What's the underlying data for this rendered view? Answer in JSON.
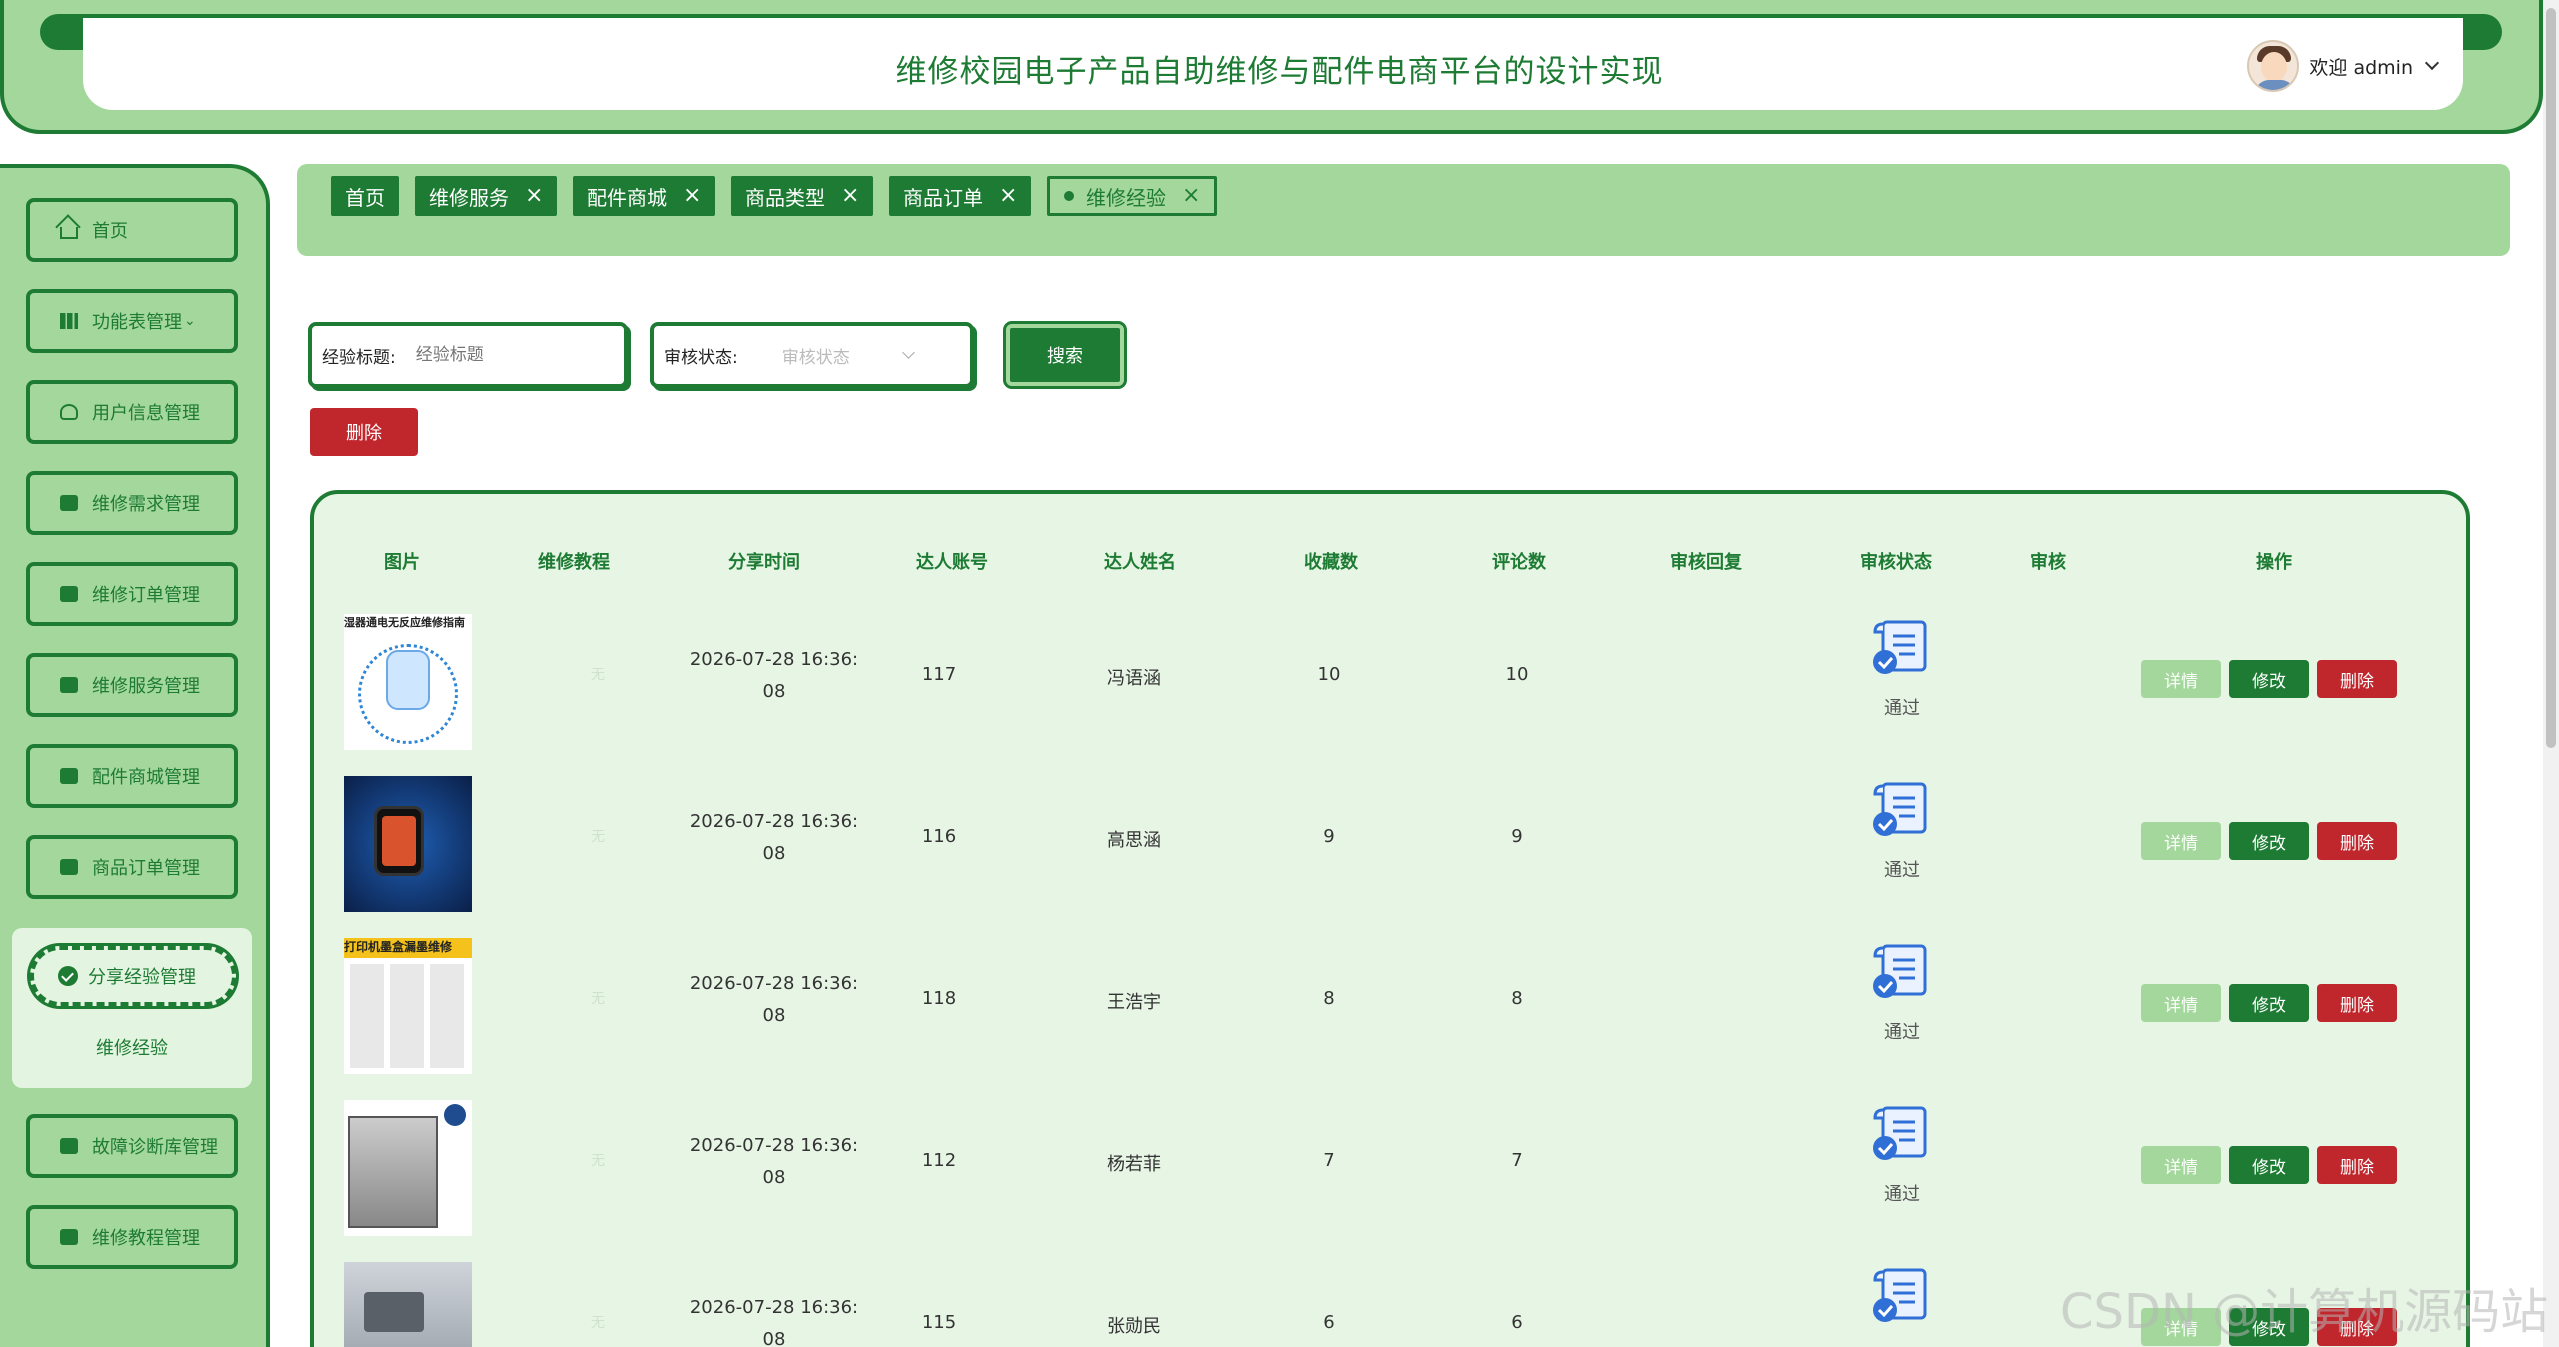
{
  "header": {
    "title": "维修校园电子产品自助维修与配件电商平台的设计实现",
    "welcome": "欢迎 admin"
  },
  "sidebar": {
    "items": [
      {
        "label": "首页",
        "icon": "home-icon"
      },
      {
        "label": "功能表管理",
        "icon": "building-icon"
      },
      {
        "label": "用户信息管理",
        "icon": "user-icon"
      },
      {
        "label": "维修需求管理",
        "icon": "gear-icon"
      },
      {
        "label": "维修订单管理",
        "icon": "cart-icon"
      },
      {
        "label": "维修服务管理",
        "icon": "folder-icon"
      },
      {
        "label": "配件商城管理",
        "icon": "gear-icon"
      },
      {
        "label": "商品订单管理",
        "icon": "card-icon"
      },
      {
        "label": "分享经验管理",
        "icon": "check-circle-icon"
      },
      {
        "label": "故障诊断库管理",
        "icon": "cart-icon"
      },
      {
        "label": "维修教程管理",
        "icon": "id-card-icon"
      }
    ],
    "active_sub": "维修经验"
  },
  "tabs": [
    {
      "label": "首页"
    },
    {
      "label": "维修服务"
    },
    {
      "label": "配件商城"
    },
    {
      "label": "商品类型"
    },
    {
      "label": "商品订单"
    },
    {
      "label": "维修经验"
    }
  ],
  "search": {
    "title_label": "经验标题:",
    "title_placeholder": "经验标题",
    "status_label": "审核状态:",
    "status_placeholder": "审核状态",
    "search_button": "搜索",
    "delete_button": "删除"
  },
  "table": {
    "columns": [
      "图片",
      "维修教程",
      "分享时间",
      "达人账号",
      "达人姓名",
      "收藏数",
      "评论数",
      "审核回复",
      "审核状态",
      "审核",
      "操作"
    ],
    "rows": [
      {
        "thumb_caption": "湿器通电无反应维修指南",
        "tutorial": "无",
        "time1": "2026-07-28 16:36:",
        "time2": "08",
        "account": "117",
        "name": "冯语涵",
        "fav": "10",
        "comments": "10",
        "status": "通过"
      },
      {
        "thumb_caption": "",
        "tutorial": "无",
        "time1": "2026-07-28 16:36:",
        "time2": "08",
        "account": "116",
        "name": "高思涵",
        "fav": "9",
        "comments": "9",
        "status": "通过"
      },
      {
        "thumb_caption": "打印机墨盒漏墨维修",
        "tutorial": "无",
        "time1": "2026-07-28 16:36:",
        "time2": "08",
        "account": "118",
        "name": "王浩宇",
        "fav": "8",
        "comments": "8",
        "status": "通过"
      },
      {
        "thumb_caption": "",
        "tutorial": "无",
        "time1": "2026-07-28 16:36:",
        "time2": "08",
        "account": "112",
        "name": "杨若菲",
        "fav": "7",
        "comments": "7",
        "status": "通过"
      },
      {
        "thumb_caption": "",
        "tutorial": "无",
        "time1": "2026-07-28 16:36:",
        "time2": "08",
        "account": "115",
        "name": "张勋民",
        "fav": "6",
        "comments": "6",
        "status": ""
      }
    ],
    "ops": {
      "detail": "详情",
      "edit": "修改",
      "delete": "删除"
    }
  },
  "watermark": "CSDN @计算机源码站",
  "colors": {
    "primary": "#1e7b34",
    "light": "#a3d79b",
    "danger": "#c0272d",
    "table_bg": "#e6f5e4"
  }
}
